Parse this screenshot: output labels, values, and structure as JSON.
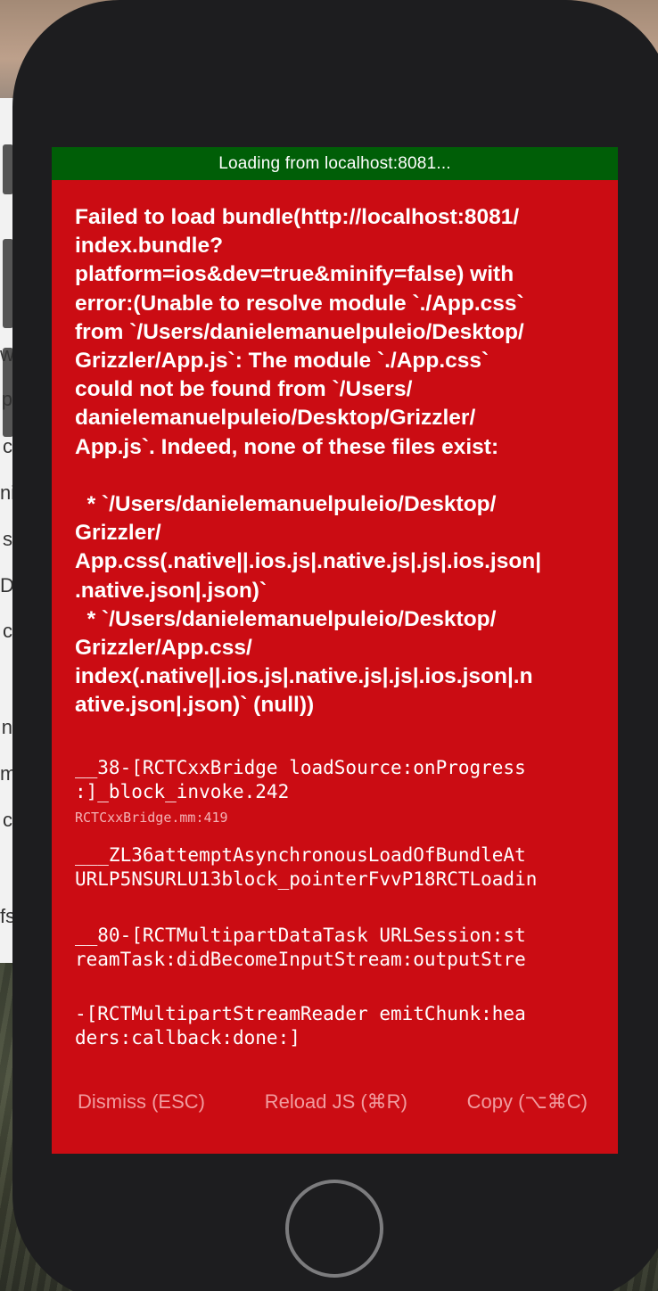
{
  "banner": {
    "text": "Loading from localhost:8081..."
  },
  "error": {
    "message": "Failed to load bundle(http://localhost:8081/\nindex.bundle?\nplatform=ios&dev=true&minify=false) with\nerror:(Unable to resolve module `./App.css`\nfrom `/Users/danielemanuelpuleio/Desktop/\nGrizzler/App.js`: The module `./App.css`\ncould not be found from `/Users/\ndanielemanuelpuleio/Desktop/Grizzler/\nApp.js`. Indeed, none of these files exist:\n\n  * `/Users/danielemanuelpuleio/Desktop/\nGrizzler/\nApp.css(.native||.ios.js|.native.js|.js|.ios.json|\n.native.json|.json)`\n  * `/Users/danielemanuelpuleio/Desktop/\nGrizzler/App.css/\nindex(.native||.ios.js|.native.js|.js|.ios.json|.n\native.json|.json)` (null))"
  },
  "stack": [
    {
      "method": "__38-[RCTCxxBridge loadSource:onProgress\n:]_block_invoke.242",
      "file": "RCTCxxBridge.mm:419"
    },
    {
      "method": "___ZL36attemptAsynchronousLoadOfBundleAt\nURLP5NSURLU13block_pointerFvvP18RCTLoadin",
      "file": ""
    },
    {
      "method": "__80-[RCTMultipartDataTask URLSession:st\nreamTask:didBecomeInputStream:outputStre",
      "file": ""
    },
    {
      "method": "-[RCTMultipartStreamReader emitChunk:hea\nders:callback:done:]",
      "file": ""
    }
  ],
  "buttons": {
    "dismiss": "Dismiss (ESC)",
    "reload": "Reload JS (⌘R)",
    "copy": "Copy (⌥⌘C)"
  },
  "background_fragments": [
    "w",
    "p",
    "c",
    "ni",
    "s",
    "D",
    "c",
    "n",
    "m",
    "c",
    "fs"
  ],
  "colors": {
    "banner_bg": "#005e07",
    "error_bg": "#cb0c13",
    "button_text": "#f19c9f"
  }
}
